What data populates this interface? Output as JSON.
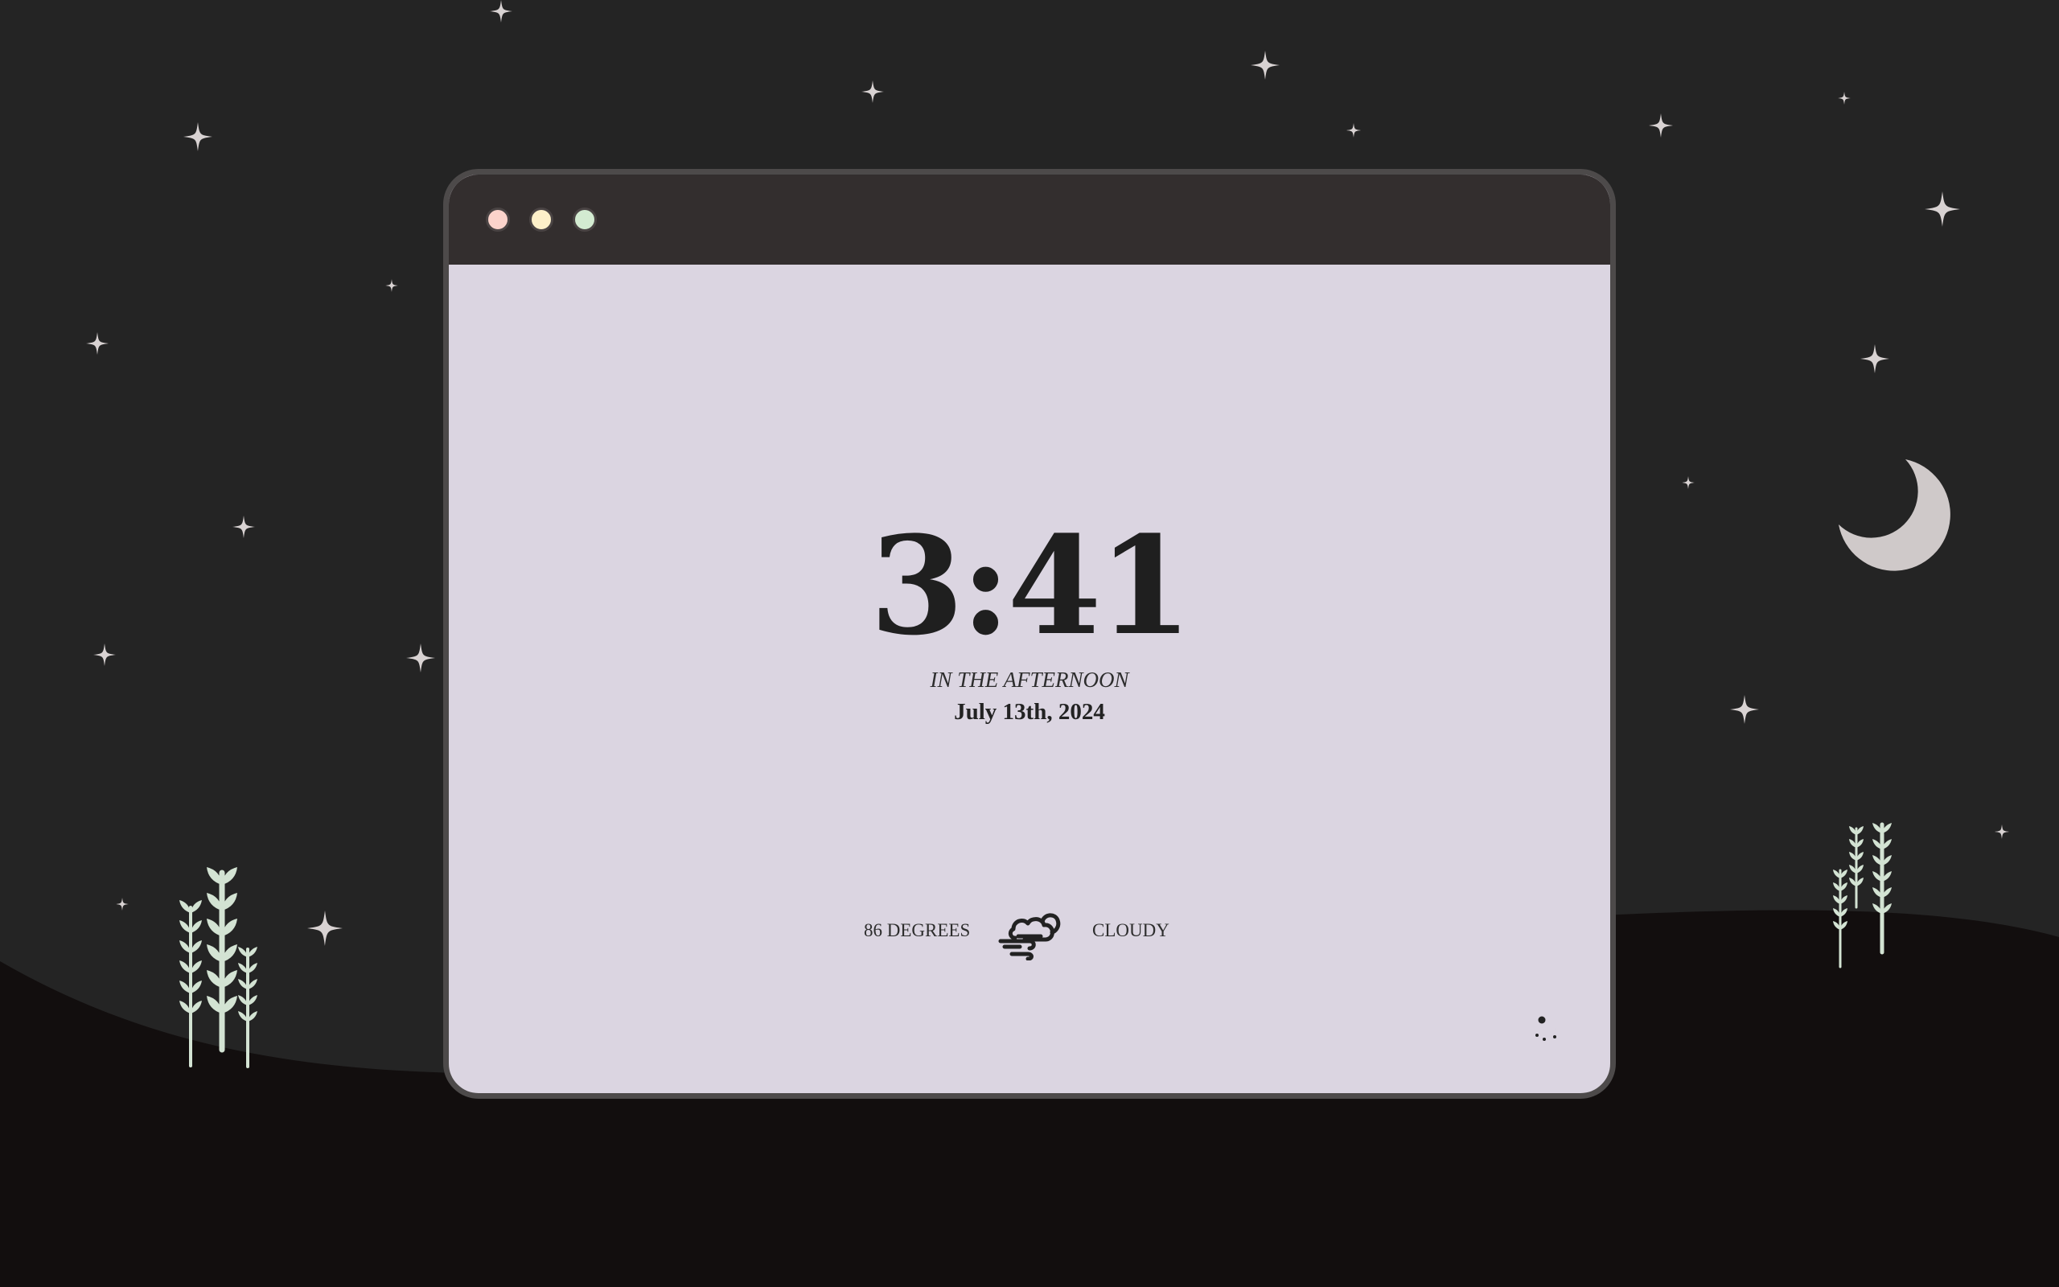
{
  "clock": {
    "time": "3:41",
    "period": "IN THE AFTERNOON",
    "date": "July 13th, 2024"
  },
  "weather": {
    "temperature": "86 DEGREES",
    "condition": "CLOUDY",
    "icon": "wind-cloud-icon"
  },
  "window_controls": [
    "close",
    "minimize",
    "maximize"
  ],
  "colors": {
    "background": "#242424",
    "ground": "#120e0e",
    "window_frame": "#4d4a4a",
    "titlebar": "#332e2e",
    "window_body": "#dbd5e1",
    "close_dot": "#fbd3cb",
    "minimize_dot": "#fdf0c9",
    "maximize_dot": "#d3ebd1",
    "stars": "#d8d2d2",
    "moon": "#cfc9c9",
    "plants": "#d3e3d3",
    "text": "#222222"
  },
  "theme_toggle_icon": "moon-stars-icon"
}
